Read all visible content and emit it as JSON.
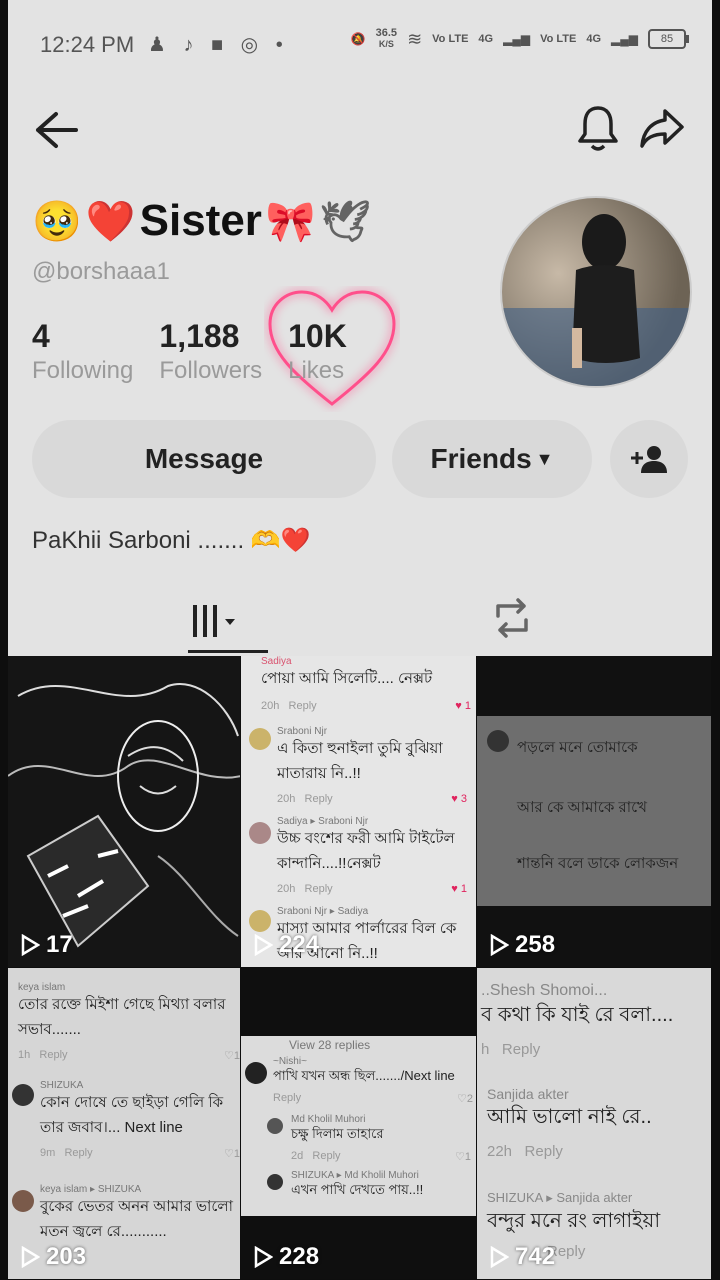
{
  "status": {
    "time": "12:24 PM",
    "speed_top": "36.5",
    "speed_unit": "K/S",
    "battery": "85",
    "net1": "Vo LTE",
    "net2": "4G",
    "net3": "Vo LTE",
    "net4": "4G"
  },
  "profile": {
    "display_name": "Sister",
    "handle": "@borshaaa1",
    "stats": [
      {
        "num": "4",
        "label": "Following"
      },
      {
        "num": "1,188",
        "label": "Followers"
      },
      {
        "num": "10K",
        "label": "Likes"
      }
    ],
    "bio": "PaKhii Sarboni ......."
  },
  "buttons": {
    "message": "Message",
    "friends": "Friends"
  },
  "colors": {
    "accent_glow": "#ff4f8b",
    "screen_bg": "#e3e3e3"
  },
  "videos": [
    {
      "views": "17"
    },
    {
      "views": "224",
      "comments": [
        {
          "who": "Sadiya",
          "text": "পোয়া আমি সিলেটি.... নেক্সট",
          "time": "20h",
          "reply": "Reply",
          "likes": "1"
        },
        {
          "who": "Sraboni Njr",
          "text": "এ কিতা হুনাইলা তুমি বুঝিয়া মাতারায় নি..!!",
          "time": "20h",
          "reply": "Reply",
          "likes": "3"
        },
        {
          "who": "Sadiya ▸ Sraboni Njr",
          "text": "উচ্চ বংশের ফরী আমি টাইটেল কান্দানি....!!নেক্সট",
          "time": "20h",
          "reply": "Reply",
          "likes": "1"
        },
        {
          "who": "Sraboni Njr ▸ Sadiya",
          "text": "মাস্যা আমার পার্লারের বিল কে আর আনো নি..!!",
          "time": "",
          "reply": "",
          "likes": ""
        }
      ]
    },
    {
      "views": "258",
      "comments": [
        {
          "text": "পড়লে মনে তোমাকে"
        },
        {
          "text": "আর কে আমাকে রাখে"
        },
        {
          "text": "শান্তনি বলে ডাকে লোকজন"
        }
      ]
    },
    {
      "views": "203",
      "comments": [
        {
          "who": "keya islam",
          "text": "তোর রক্তে মিইশা গেছে মিথ্যা বলার সভাব.......",
          "time": "1h",
          "reply": "Reply",
          "likes": "1"
        },
        {
          "who": "SHIZUKA",
          "text": "কোন দোষে তে ছাইড়া গেলি কি তার জবাব।... Next line",
          "time": "9m",
          "reply": "Reply",
          "likes": "1"
        },
        {
          "who": "keya islam ▸ SHIZUKA",
          "text": "বুকের ভেতর অনন আমার ভালো মতন জ্বলে রে...........",
          "time": "",
          "reply": "",
          "likes": ""
        }
      ]
    },
    {
      "views": "228",
      "comments": [
        {
          "who": "View 28 replies",
          "text": ""
        },
        {
          "who": "~Nishi~",
          "text": "পাখি যখন অন্ধ ছিল......./Next line",
          "time": "",
          "reply": "Reply",
          "likes": "2"
        },
        {
          "who": "Md Kholil Muhori",
          "text": "চক্ষু দিলাম তাহারে",
          "time": "2d",
          "reply": "Reply",
          "likes": "1"
        },
        {
          "who": "SHIZUKA ▸ Md Kholil Muhori",
          "text": "এখন পাখি দেখতে পায়..!!",
          "time": "",
          "reply": "",
          "likes": ""
        }
      ]
    },
    {
      "views": "742",
      "comments": [
        {
          "who": "..Shesh Shomoi...",
          "text": "ব কথা কি যাই রে বলা....",
          "time": "h",
          "reply": "Reply",
          "likes": ""
        },
        {
          "who": "Sanjida akter",
          "text": "আমি ভালো নাই রে..",
          "time": "22h",
          "reply": "Reply",
          "likes": ""
        },
        {
          "who": "SHIZUKA ▸ Sanjida akter",
          "text": "বন্দুর মনে রং লাগাইয়া",
          "time": "",
          "reply": "Reply",
          "likes": ""
        }
      ]
    }
  ]
}
